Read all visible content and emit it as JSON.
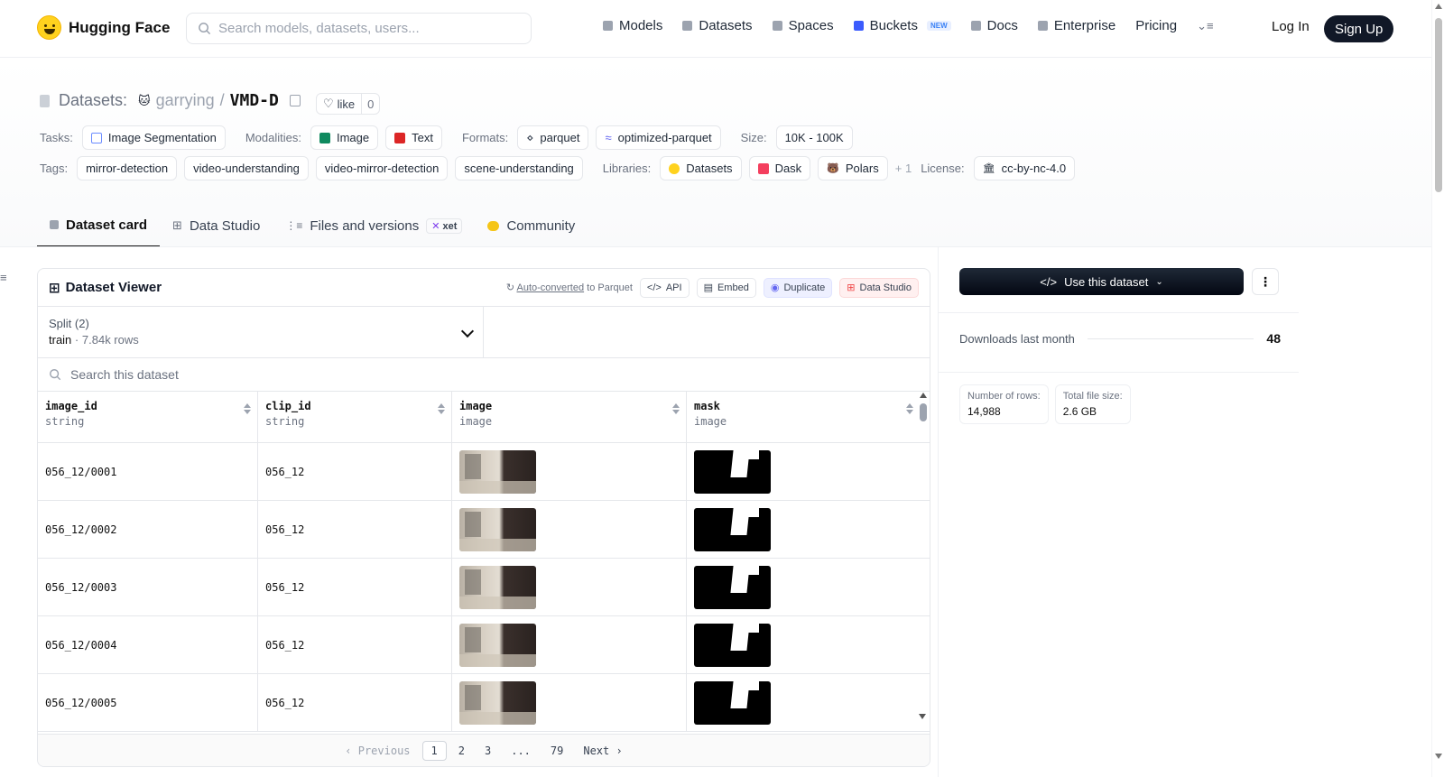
{
  "nav": {
    "brand": "Hugging Face",
    "search_placeholder": "Search models, datasets, users...",
    "links": [
      "Models",
      "Datasets",
      "Spaces",
      "Buckets",
      "Docs",
      "Enterprise",
      "Pricing"
    ],
    "new_badge": "NEW",
    "login": "Log In",
    "signup": "Sign Up"
  },
  "header": {
    "section": "Datasets:",
    "user": "garrying",
    "separator": "/",
    "repo": "VMD-D",
    "like_label": "like",
    "like_count": "0",
    "row1": {
      "tasks_label": "Tasks:",
      "task": "Image Segmentation",
      "modalities_label": "Modalities:",
      "modalities": [
        "Image",
        "Text"
      ],
      "formats_label": "Formats:",
      "formats": [
        "parquet",
        "optimized-parquet"
      ],
      "size_label": "Size:",
      "size": "10K - 100K"
    },
    "row2": {
      "tags_label": "Tags:",
      "tags": [
        "mirror-detection",
        "video-understanding",
        "video-mirror-detection",
        "scene-understanding"
      ],
      "libraries_label": "Libraries:",
      "libraries": [
        "Datasets",
        "Dask",
        "Polars"
      ],
      "libraries_more": "+ 1",
      "license_label": "License:",
      "license": "cc-by-nc-4.0"
    }
  },
  "tabs": {
    "dataset_card": "Dataset card",
    "data_studio": "Data Studio",
    "files": "Files and versions",
    "xet": "xet",
    "community": "Community"
  },
  "viewer": {
    "title": "Dataset Viewer",
    "auto_converted": "Auto-converted",
    "to_parquet": " to Parquet",
    "api": "API",
    "embed": "Embed",
    "duplicate": "Duplicate",
    "data_studio": "Data Studio",
    "split_label": "Split (2)",
    "split_name": "train",
    "split_rows": "7.84k rows",
    "search_placeholder": "Search this dataset",
    "columns": [
      {
        "name": "image_id",
        "type": "string"
      },
      {
        "name": "clip_id",
        "type": "string"
      },
      {
        "name": "image",
        "type": "image"
      },
      {
        "name": "mask",
        "type": "image"
      }
    ],
    "rows": [
      {
        "image_id": "056_12/0001",
        "clip_id": "056_12"
      },
      {
        "image_id": "056_12/0002",
        "clip_id": "056_12"
      },
      {
        "image_id": "056_12/0003",
        "clip_id": "056_12"
      },
      {
        "image_id": "056_12/0004",
        "clip_id": "056_12"
      },
      {
        "image_id": "056_12/0005",
        "clip_id": "056_12"
      }
    ],
    "pager": {
      "previous": "‹ Previous",
      "pages": [
        "1",
        "2",
        "3",
        "...",
        "79"
      ],
      "next": "Next ›"
    }
  },
  "sidebar": {
    "use_dataset": "Use this dataset",
    "downloads_label": "Downloads last month",
    "downloads": "48",
    "rows_label": "Number of rows:",
    "rows": "14,988",
    "size_label": "Total file size:",
    "size": "2.6 GB"
  },
  "colors": {
    "accent_dark": "#111827",
    "hf_yellow": "#ffd21e",
    "buckets_blue": "#3b5bfd"
  }
}
